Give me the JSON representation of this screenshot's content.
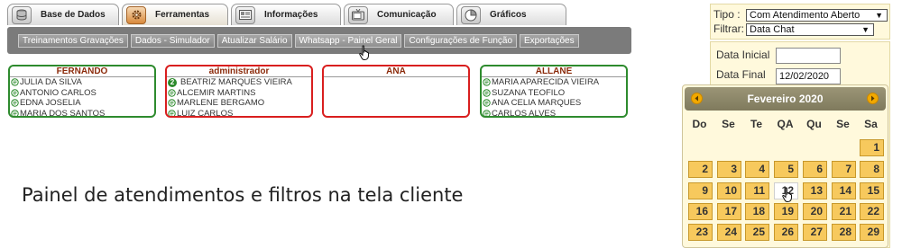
{
  "tabs": [
    {
      "label": "Base de Dados",
      "icon": "database-icon"
    },
    {
      "label": "Ferramentas",
      "icon": "gear-icon",
      "active": true
    },
    {
      "label": "Informações",
      "icon": "info-panel-icon"
    },
    {
      "label": "Comunicação",
      "icon": "tv-icon"
    },
    {
      "label": "Gráficos",
      "icon": "pie-chart-icon"
    }
  ],
  "submenu": [
    "Treinamentos Gravações",
    "Dados - Simulador",
    "Atualizar Salário",
    "Whatsapp - Painel Geral",
    "Configurações de Função",
    "Exportações"
  ],
  "cards": [
    {
      "name": "FERNANDO",
      "status": "green",
      "clients": [
        "JULIA DA SILVA",
        "ANTONIO CARLOS",
        "EDNA JOSELIA",
        "MARIA DOS SANTOS"
      ]
    },
    {
      "name": "administrador",
      "status": "red",
      "badge": "2",
      "clients": [
        "BEATRIZ MARQUES VIEIRA",
        "ALCEMIR MARTINS",
        "MARLENE BERGAMO",
        "LUIZ CARLOS"
      ]
    },
    {
      "name": "ANA",
      "status": "red",
      "clients": []
    },
    {
      "name": "ALLANE",
      "status": "green",
      "clients": [
        "MARIA APARECIDA VIEIRA",
        "SUZANA TEOFILO",
        "ANA CELIA MARQUES",
        "CARLOS ALVES"
      ]
    }
  ],
  "caption": "Painel de atendimentos e filtros na tela cliente",
  "filters": {
    "tipo_label": "Tipo :",
    "tipo_value": "Com Atendimento Aberto",
    "filtrar_label": "Filtrar:",
    "filtrar_value": "Data Chat",
    "data_inicial_label": "Data Inicial",
    "data_inicial_value": "",
    "data_final_label": "Data Final",
    "data_final_value": "12/02/2020"
  },
  "calendar": {
    "month_label": "Fevereiro 2020",
    "weekdays": [
      "Do",
      "Se",
      "Te",
      "QA",
      "Qu",
      "Se",
      "Sa"
    ],
    "first_weekday": 6,
    "days_in_month": 29,
    "today": 12
  },
  "colors": {
    "active_green": "#2e8b2e",
    "alert_red": "#d91f1f",
    "calendar_day": "#f7c95d",
    "accent_orange": "#f2a900"
  }
}
